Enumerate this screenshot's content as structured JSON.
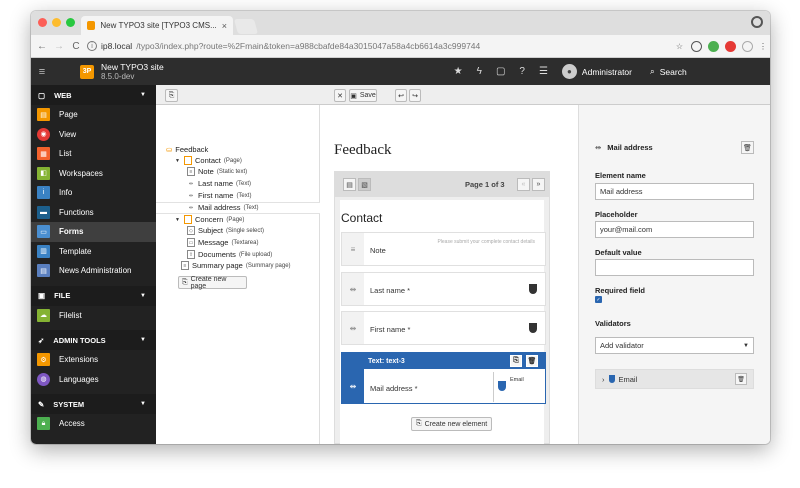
{
  "browser": {
    "tab_title": "New TYPO3 site [TYPO3 CMS...",
    "tab_close": "×",
    "url_host": "ip8.local",
    "url_path": "/typo3/index.php?route=%2Fmain&token=a988cbafde84a3015047a58a4cb6614a3c999744"
  },
  "topbar": {
    "site_name": "New TYPO3 site",
    "site_version": "8.5.0-dev",
    "user_name": "Administrator",
    "search_label": "Search",
    "logo_text": "3P"
  },
  "sidebar": {
    "groups": [
      {
        "label": "WEB",
        "items": [
          "Page",
          "View",
          "List",
          "Workspaces",
          "Info",
          "Functions",
          "Forms",
          "Template",
          "News Administration"
        ]
      },
      {
        "label": "FILE",
        "items": [
          "Filelist"
        ]
      },
      {
        "label": "ADMIN TOOLS",
        "items": [
          "Extensions",
          "Languages"
        ]
      },
      {
        "label": "SYSTEM",
        "items": [
          "Access"
        ]
      }
    ],
    "active": "Forms"
  },
  "docbar": {
    "save_label": "Save"
  },
  "tree": {
    "root": "Feedback",
    "nodes": [
      {
        "label": "Contact",
        "type": "(Page)"
      },
      {
        "label": "Note",
        "type": "(Static text)"
      },
      {
        "label": "Last name",
        "type": "(Text)"
      },
      {
        "label": "First name",
        "type": "(Text)"
      },
      {
        "label": "Mail address",
        "type": "(Text)"
      },
      {
        "label": "Concern",
        "type": "(Page)"
      },
      {
        "label": "Subject",
        "type": "(Single select)"
      },
      {
        "label": "Message",
        "type": "(Textarea)"
      },
      {
        "label": "Documents",
        "type": "(File upload)"
      },
      {
        "label": "Summary page",
        "type": "(Summary page)"
      }
    ],
    "create_page_label": "Create new page"
  },
  "stage": {
    "form_title": "Feedback",
    "pagination": "Page 1 of 3",
    "page_title": "Contact",
    "elements": [
      {
        "label": "Note",
        "hint": "Please submit your complete contact details"
      },
      {
        "label": "Last name *"
      },
      {
        "label": "First name *"
      }
    ],
    "selected": {
      "header": "Text: text-3",
      "label": "Mail address *",
      "validator": "Email"
    },
    "create_element_label": "Create new element"
  },
  "inspector": {
    "title": "Mail address",
    "element_name_label": "Element name",
    "element_name_value": "Mail address",
    "placeholder_label": "Placeholder",
    "placeholder_value": "your@mail.com",
    "default_value_label": "Default value",
    "default_value_value": "",
    "required_label": "Required field",
    "validators_label": "Validators",
    "add_validator": "Add validator",
    "validator_item": "Email"
  },
  "colors": {
    "accent": "#2a66b0",
    "typo3_orange": "#f49700",
    "sidebar_bg": "#222222"
  }
}
